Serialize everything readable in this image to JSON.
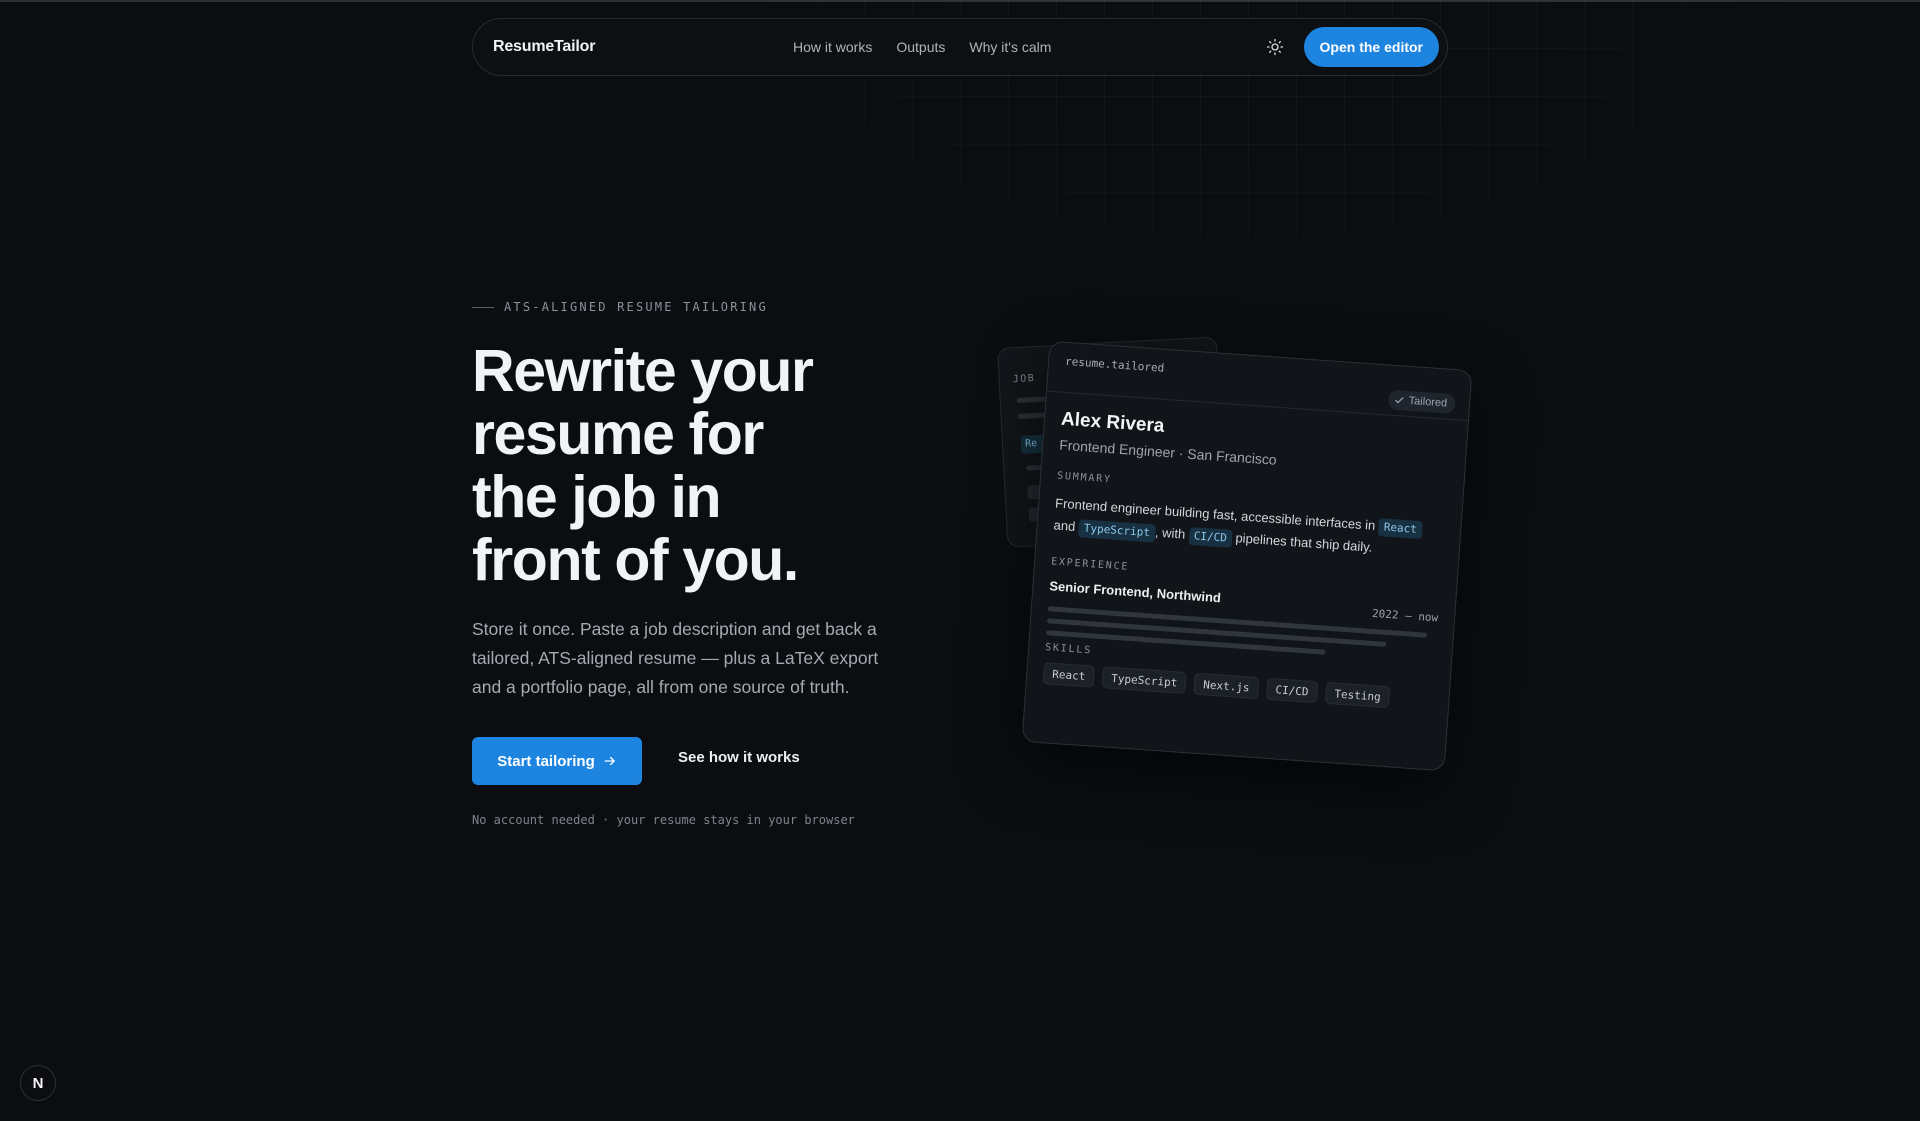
{
  "nav": {
    "brand": "ResumeTailor",
    "links": [
      "How it works",
      "Outputs",
      "Why it's calm"
    ],
    "theme_icon": "sun-icon",
    "cta_label": "Open the editor"
  },
  "hero": {
    "eyebrow": "ATS-ALIGNED RESUME TAILORING",
    "headline_lines": [
      "Rewrite your",
      "resume for",
      "the job in",
      "front of you."
    ],
    "subcopy_lines": [
      "Store it once. Paste a job description and get back a",
      "tailored, ATS-aligned resume — plus a LaTeX export",
      "and a portfolio page, all from one source of truth."
    ],
    "primary_button": "Start tailoring",
    "primary_icon": "arrow-right-icon",
    "secondary_button": "See how it works",
    "footnote": "No account needed · your resume stays in your browser"
  },
  "back_card": {
    "label": "JOB",
    "chip": "Re"
  },
  "resume_card": {
    "file": "resume.tailored",
    "badge": "Tailored",
    "badge_icon": "check-icon",
    "name": "Alex Rivera",
    "role": "Frontend Engineer · San Francisco",
    "summary_label": "SUMMARY",
    "summary": {
      "t1": "Frontend engineer building fast, accessible interfaces in",
      "k1": "React",
      "t2": "and",
      "k2": "TypeScript",
      "t3": ", with",
      "k3": "CI/CD",
      "t4": "pipelines that ship daily."
    },
    "experience_label": "EXPERIENCE",
    "job_title": "Senior Frontend, Northwind",
    "job_dates": "2022 – now",
    "skills_label": "SKILLS",
    "skills": [
      "React",
      "TypeScript",
      "Next.js",
      "CI/CD",
      "Testing"
    ]
  },
  "footer": {
    "next_badge": "N"
  },
  "colors": {
    "background": "#0b0d10",
    "accent": "#1d84e0",
    "keyword_bg": "#173042",
    "keyword_text": "#8cc8ea"
  }
}
